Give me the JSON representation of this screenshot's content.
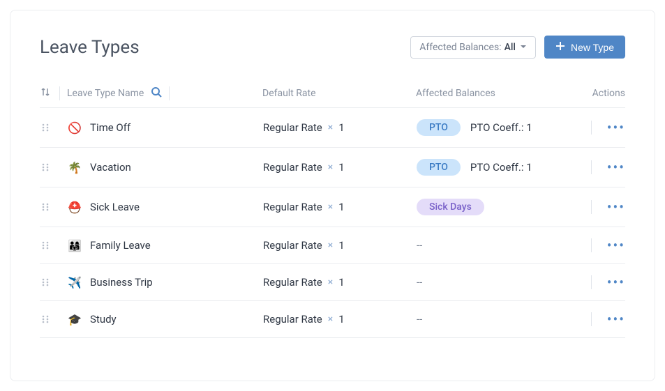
{
  "header": {
    "title": "Leave Types",
    "filter_label": "Affected Balances:",
    "filter_value": "All",
    "new_button": "New Type"
  },
  "columns": {
    "name": "Leave Type Name",
    "rate": "Default Rate",
    "balances": "Affected Balances",
    "actions": "Actions"
  },
  "rows": [
    {
      "icon": "🚫",
      "name": "Time Off",
      "rate_label": "Regular Rate",
      "rate_mult": "1",
      "balances": [
        {
          "text": "PTO",
          "style": "pto"
        }
      ],
      "coeff": "PTO Coeff.: 1"
    },
    {
      "icon": "🌴",
      "name": "Vacation",
      "rate_label": "Regular Rate",
      "rate_mult": "1",
      "balances": [
        {
          "text": "PTO",
          "style": "pto"
        }
      ],
      "coeff": "PTO Coeff.: 1"
    },
    {
      "icon": "⛑️",
      "name": "Sick Leave",
      "rate_label": "Regular Rate",
      "rate_mult": "1",
      "balances": [
        {
          "text": "Sick Days",
          "style": "sick"
        }
      ],
      "coeff": ""
    },
    {
      "icon": "👨‍👩‍👧",
      "name": "Family Leave",
      "rate_label": "Regular Rate",
      "rate_mult": "1",
      "balances": [],
      "coeff": ""
    },
    {
      "icon": "✈️",
      "name": "Business Trip",
      "rate_label": "Regular Rate",
      "rate_mult": "1",
      "balances": [],
      "coeff": ""
    },
    {
      "icon": "🎓",
      "name": "Study",
      "rate_label": "Regular Rate",
      "rate_mult": "1",
      "balances": [],
      "coeff": ""
    }
  ],
  "empty_balance_text": "--",
  "rate_multiplier_symbol": "×"
}
